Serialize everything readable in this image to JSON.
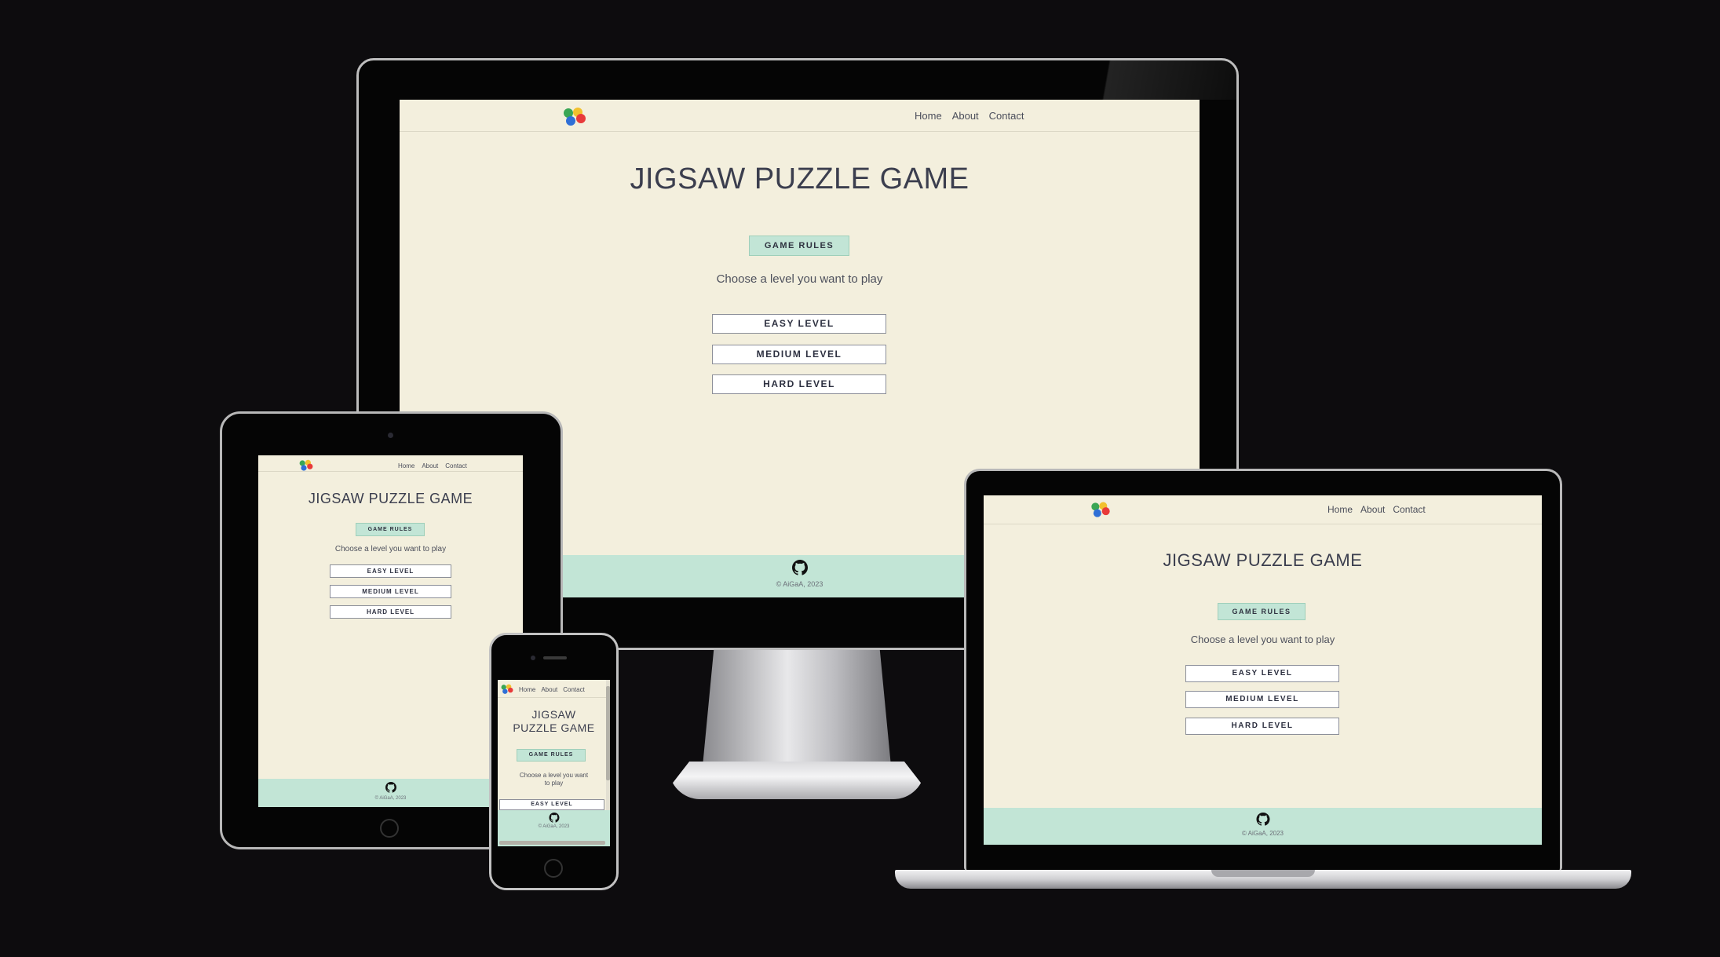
{
  "site": {
    "nav": {
      "links": [
        "Home",
        "About",
        "Contact"
      ]
    },
    "title": "JIGSAW PUZZLE GAME",
    "title_phone": [
      "JIGSAW",
      "PUZZLE GAME"
    ],
    "rules_label": "GAME RULES",
    "choose_text": "Choose a level you want to play",
    "choose_text_phone": [
      "Choose a level you want",
      "to play"
    ],
    "levels": [
      "EASY LEVEL",
      "MEDIUM LEVEL",
      "HARD LEVEL"
    ],
    "footer": {
      "copyright": "© AiGaA, 2023"
    }
  },
  "colors": {
    "page_bg": "#f3efdd",
    "accent": "#c2e5d6",
    "text": "#3a3d4a",
    "backdrop": "#0d0c0e"
  },
  "icons": {
    "logo": "puzzle-pieces-logo",
    "footer": "github-icon"
  }
}
